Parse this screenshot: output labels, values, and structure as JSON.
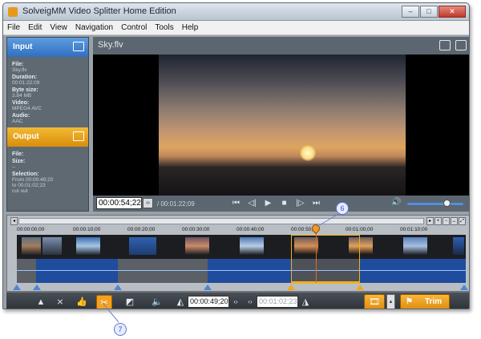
{
  "window": {
    "title": "SolveigMM Video Splitter Home Edition",
    "controls": [
      "–",
      "□",
      "✕"
    ]
  },
  "menu": [
    "File",
    "Edit",
    "View",
    "Navigation",
    "Control",
    "Tools",
    "Help"
  ],
  "input": {
    "title": "Input",
    "fields": [
      {
        "label": "File:",
        "value": "Sky.flv"
      },
      {
        "label": "Duration:",
        "value": "00:01:22;09"
      },
      {
        "label": "Byte size:",
        "value": "3.84 MB"
      },
      {
        "label": "Video:",
        "value": "MPEG4 AVC"
      },
      {
        "label": "Audio:",
        "value": "AAC"
      }
    ]
  },
  "output": {
    "title": "Output",
    "fields": [
      {
        "label": "File:",
        "value": ""
      },
      {
        "label": "Size:",
        "value": "--"
      },
      {
        "label": "Selection:",
        "value": "From  00:00:49;20"
      },
      {
        "label": "",
        "value": "to      00:01:02;23"
      },
      {
        "label": "",
        "value": "cut out"
      }
    ]
  },
  "player": {
    "filename": "Sky.flv",
    "current_time": "00:00:54;22",
    "duration": "/ 00:01:22;09",
    "volume": 0.7
  },
  "timeline": {
    "tick_labels": [
      "00:00:00;00",
      "00:00:10;00",
      "00:00:20;00",
      "00:00:30;00",
      "00:00:40;00",
      "00:00:50;00",
      "00:01:00;00",
      "00:01:10;00"
    ]
  },
  "toolbar": {
    "start_time": "00:00:49;20",
    "end_time": "00:01:02;23",
    "trim_label": "Trim"
  },
  "callouts": [
    "6",
    "7"
  ]
}
